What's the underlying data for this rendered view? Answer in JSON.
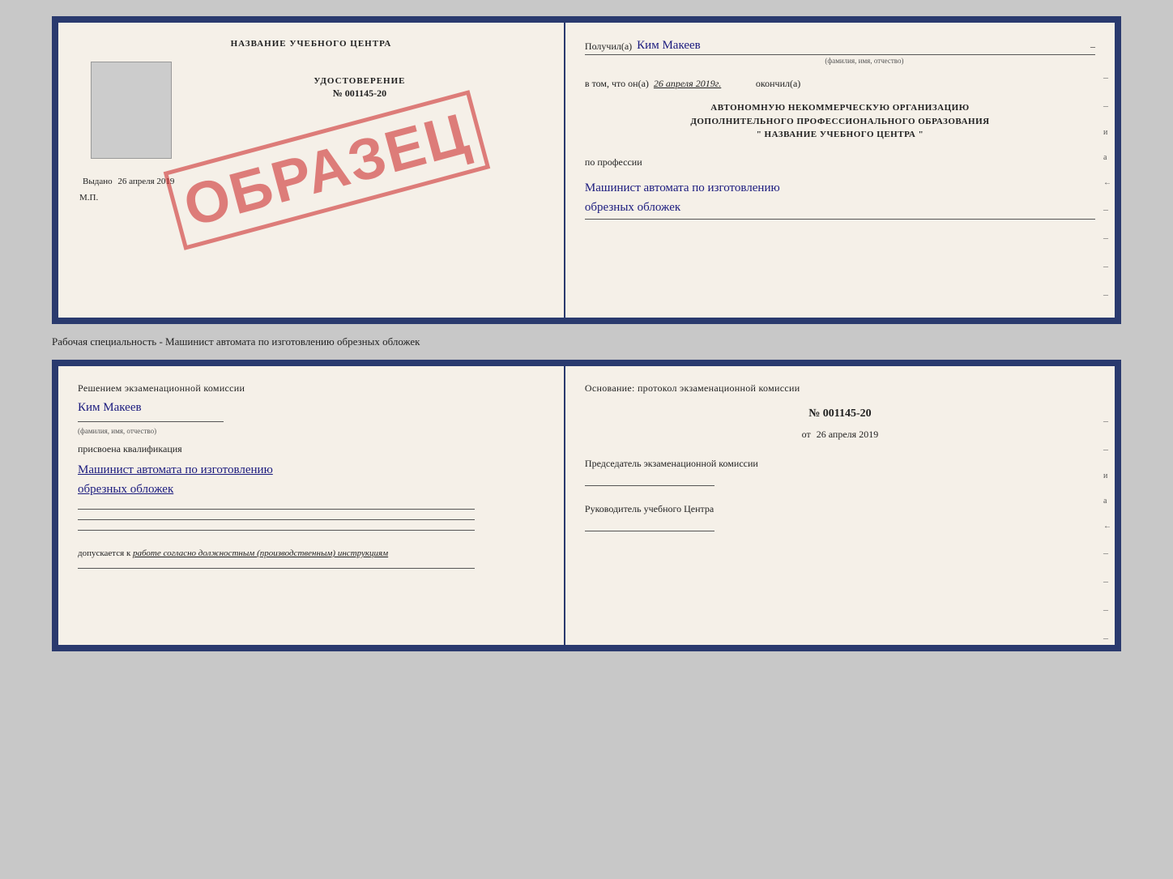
{
  "top_doc": {
    "left": {
      "school_name": "НАЗВАНИЕ УЧЕБНОГО ЦЕНТРА",
      "certificate_label": "УДОСТОВЕРЕНИЕ",
      "number": "№ 001145-20",
      "vydano_prefix": "Выдано",
      "vydano_date": "26 апреля 2019",
      "mp_label": "М.П.",
      "stamp_text": "ОБРАЗЕЦ"
    },
    "right": {
      "poluchil_prefix": "Получил(а)",
      "poluchil_name": "Ким Макеев",
      "fio_hint": "(фамилия, имя, отчество)",
      "vtom_prefix": "в том, что он(а)",
      "vtom_date": "26 апреля 2019г.",
      "okonchil": "окончил(а)",
      "org_line1": "АВТОНОМНУЮ НЕКОММЕРЧЕСКУЮ ОРГАНИЗАЦИЮ",
      "org_line2": "ДОПОЛНИТЕЛЬНОГО ПРОФЕССИОНАЛЬНОГО ОБРАЗОВАНИЯ",
      "org_line3": "\"  НАЗВАНИЕ УЧЕБНОГО ЦЕНТРА  \"",
      "po_professii": "по профессии",
      "profession_line1": "Машинист автомата по изготовлению",
      "profession_line2": "обрезных обложек"
    }
  },
  "caption": {
    "text": "Рабочая специальность - Машинист автомата по изготовлению обрезных обложек"
  },
  "bottom_doc": {
    "left": {
      "resheniem_text": "Решением экзаменационной комиссии",
      "name_hw": "Ким Макеев",
      "fio_hint": "(фамилия, имя, отчество)",
      "prisvoena": "присвоена квалификация",
      "qualification_line1": "Машинист автомата по изготовлению",
      "qualification_line2": "обрезных обложек",
      "dopuskaetsya_prefix": "допускается к",
      "dopuskaetsya_italic": "работе согласно должностным (производственным) инструкциям"
    },
    "right": {
      "osnovanie_text": "Основание: протокол экзаменационной комиссии",
      "protocol_number": "№ 001145-20",
      "ot_prefix": "от",
      "ot_date": "26 апреля 2019",
      "chairman_label": "Председатель экзаменационной комиссии",
      "rukovoditel_label": "Руководитель учебного Центра"
    }
  },
  "side_marks": {
    "items": [
      "и",
      "а",
      "←",
      "–",
      "–",
      "–",
      "–"
    ]
  }
}
